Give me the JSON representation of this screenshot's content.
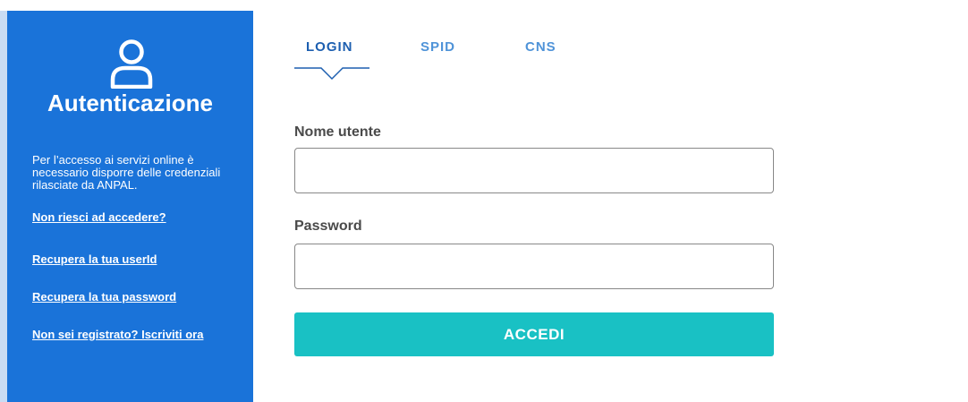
{
  "sidebar": {
    "icon": "user-icon",
    "title": "Autenticazione",
    "description": "Per l’accesso ai servizi online è necessario disporre delle credenziali rilasciate da ANPAL.",
    "links": [
      "Non riesci ad accedere?",
      "Recupera la tua userId",
      "Recupera la tua password",
      "Non sei registrato? Iscriviti ora"
    ],
    "background_color": "#1a73d9"
  },
  "tabs": [
    {
      "label": "LOGIN",
      "active": true
    },
    {
      "label": "SPID",
      "active": false
    },
    {
      "label": "CNS",
      "active": false
    }
  ],
  "form": {
    "username_label": "Nome utente",
    "username_value": "",
    "password_label": "Password",
    "password_value": "",
    "submit_label": "ACCEDI",
    "submit_color": "#19c1c4"
  }
}
